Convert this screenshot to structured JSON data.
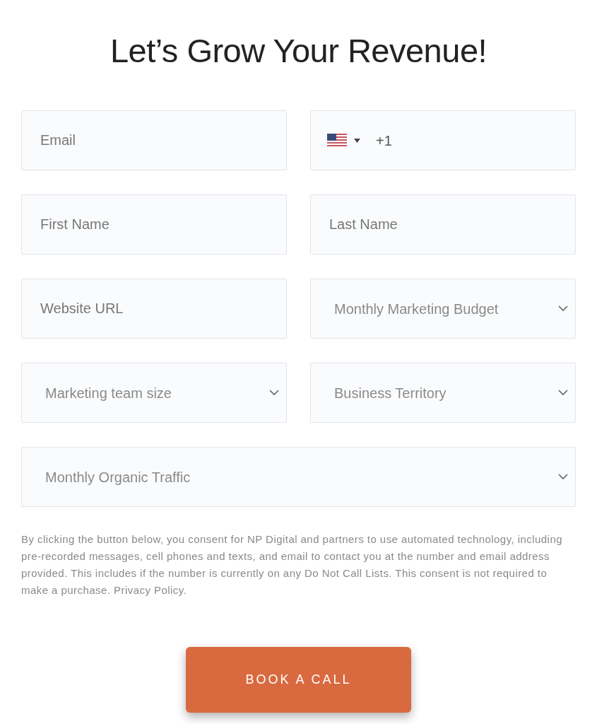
{
  "heading": "Let’s Grow Your Revenue!",
  "fields": [
    {
      "kind": "input",
      "placeholder": "Email",
      "full": false
    },
    {
      "kind": "phone",
      "value": "+1",
      "full": false
    },
    {
      "kind": "input",
      "placeholder": "First Name",
      "full": false
    },
    {
      "kind": "input",
      "placeholder": "Last Name",
      "full": false
    },
    {
      "kind": "input",
      "placeholder": "Website URL",
      "full": false
    },
    {
      "kind": "select",
      "placeholder": "Monthly Marketing Budget",
      "full": false
    },
    {
      "kind": "select",
      "placeholder": "Marketing team size",
      "full": false
    },
    {
      "kind": "select",
      "placeholder": "Business Territory",
      "full": false
    },
    {
      "kind": "select",
      "placeholder": "Monthly Organic Traffic",
      "full": true
    }
  ],
  "consent": "By clicking the button below, you consent for NP Digital and partners to use automated technology, including pre-recorded messages, cell phones and texts, and email to contact you at the number and email address provided. This includes if the number is currently on any Do Not Call Lists. This consent is not required to make a purchase. Privacy Policy.",
  "button": "BOOK A CALL"
}
